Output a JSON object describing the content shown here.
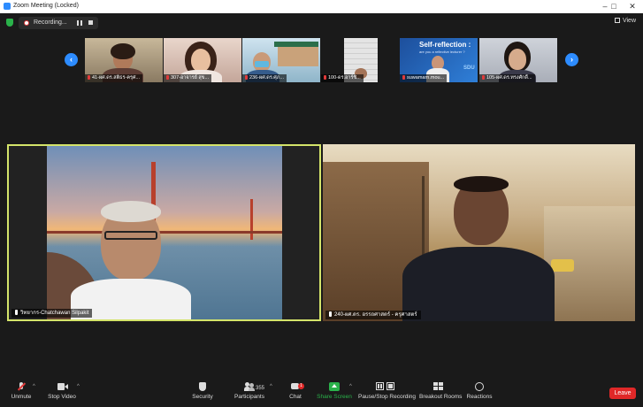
{
  "window": {
    "title": "Zoom Meeting (Locked)"
  },
  "recording": {
    "label": "Recording..."
  },
  "view_button": {
    "label": "View"
  },
  "gallery": {
    "thumbnails": [
      {
        "name": "41-ผศ.ดร.สติธร-ครุศ..."
      },
      {
        "name": "307-อาจารย์ สุข..."
      },
      {
        "name": "236-ผศ.ดร.ศุภ..."
      },
      {
        "name": "100-ดร.อาร์ชิ..."
      },
      {
        "name": "suwamarn.mou...",
        "slide_title": "Self-reflection :",
        "slide_sub": "are you a reflective lecturer ?",
        "slide_logo": "SDU"
      },
      {
        "name": "105-ผศ.ดร.ทรงศักดิ์..."
      }
    ]
  },
  "main_tiles": [
    {
      "name": "วิทยากร-Chatchawan Silpakit"
    },
    {
      "name": "240-ผศ.ดร. อรรถศาสตร์ - ครุศาสตร์"
    }
  ],
  "toolbar": {
    "unmute": "Unmute",
    "stop_video": "Stop Video",
    "security": "Security",
    "participants": "Participants",
    "participants_count": "355",
    "chat": "Chat",
    "chat_badge": "1",
    "share_screen": "Share Screen",
    "pause_stop_recording": "Pause/Stop Recording",
    "breakout_rooms": "Breakout Rooms",
    "reactions": "Reactions",
    "leave": "Leave"
  },
  "colors": {
    "accent": "#2d8cff",
    "leave": "#e02828",
    "active_speaker_border": "#d4e46a",
    "share_green": "#2ab24a"
  }
}
